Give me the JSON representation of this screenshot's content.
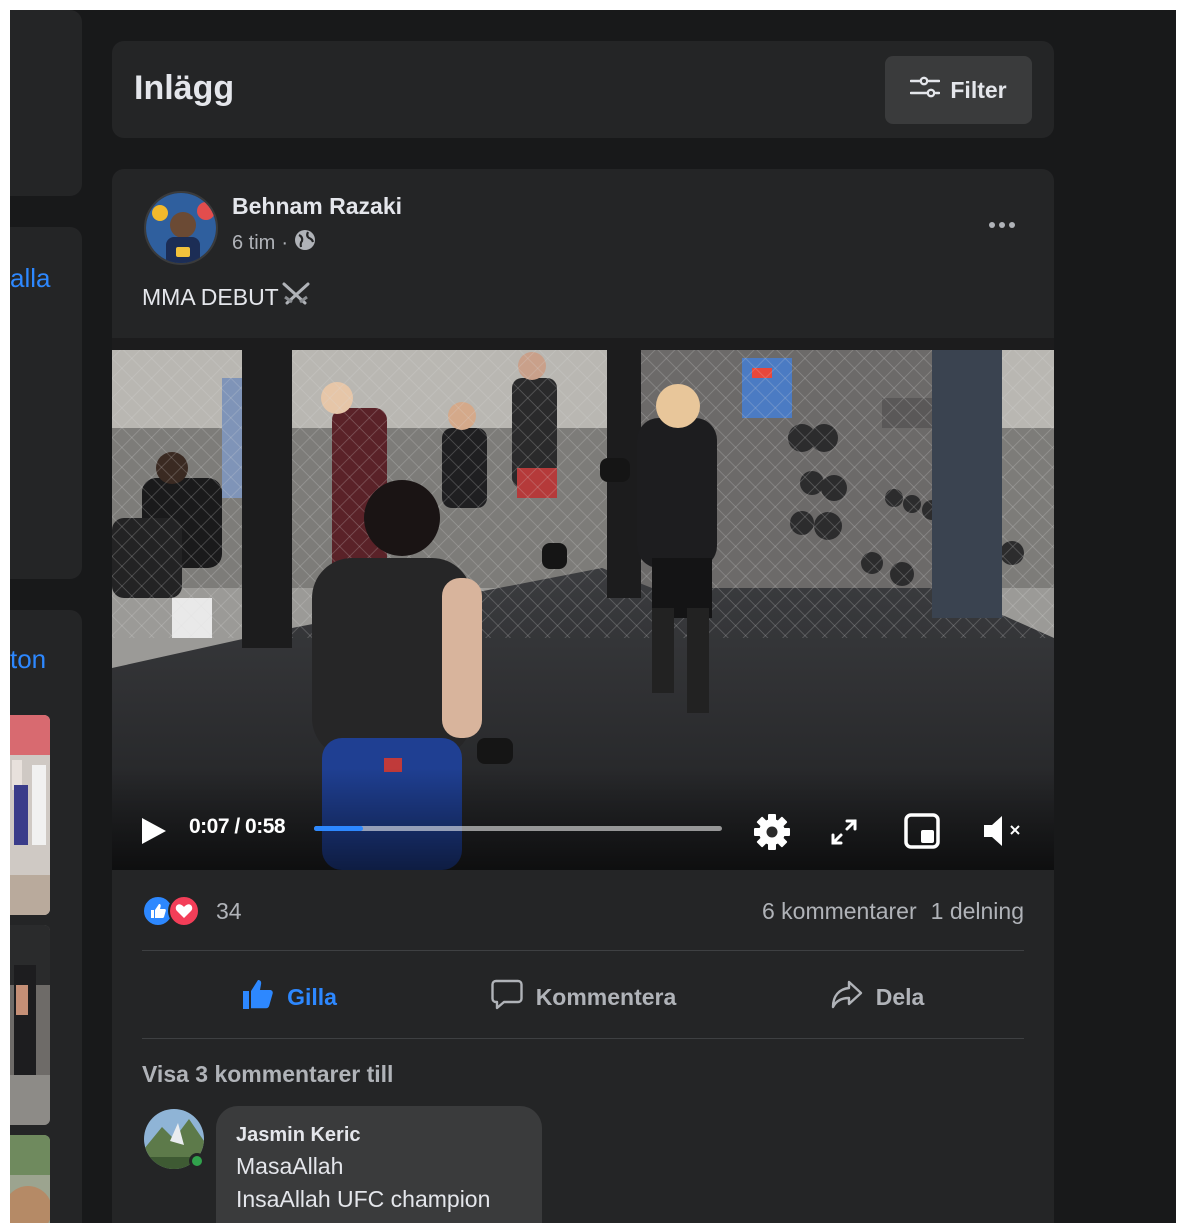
{
  "left_column": {
    "link_1": "alla",
    "link_2": "ton"
  },
  "header": {
    "title": "Inlägg",
    "filter_label": "Filter"
  },
  "post": {
    "author": "Behnam Razaki",
    "time": "6 tim",
    "separator": "·",
    "privacy_icon": "globe-icon",
    "text": "MMA DEBUT",
    "text_emoji": "crossed-swords-icon",
    "video": {
      "time_display": "0:07 / 0:58",
      "progress": 0.12
    },
    "reactions": {
      "types": [
        "like",
        "love"
      ],
      "count": "34"
    },
    "comments_count": "6 kommentarer",
    "shares_count": "1 delning",
    "actions": {
      "like": "Gilla",
      "comment": "Kommentera",
      "share": "Dela"
    },
    "view_more_comments": "Visa 3 kommentarer till",
    "comment": {
      "author": "Jasmin Keric",
      "line_1": "MasaAllah",
      "line_2": "InsaAllah UFC champion"
    }
  },
  "colors": {
    "background": "#18191a",
    "card": "#242526",
    "accent": "#2d88ff",
    "love": "#f33e58",
    "text_primary": "#e4e6eb",
    "text_secondary": "#b0b3b8"
  }
}
